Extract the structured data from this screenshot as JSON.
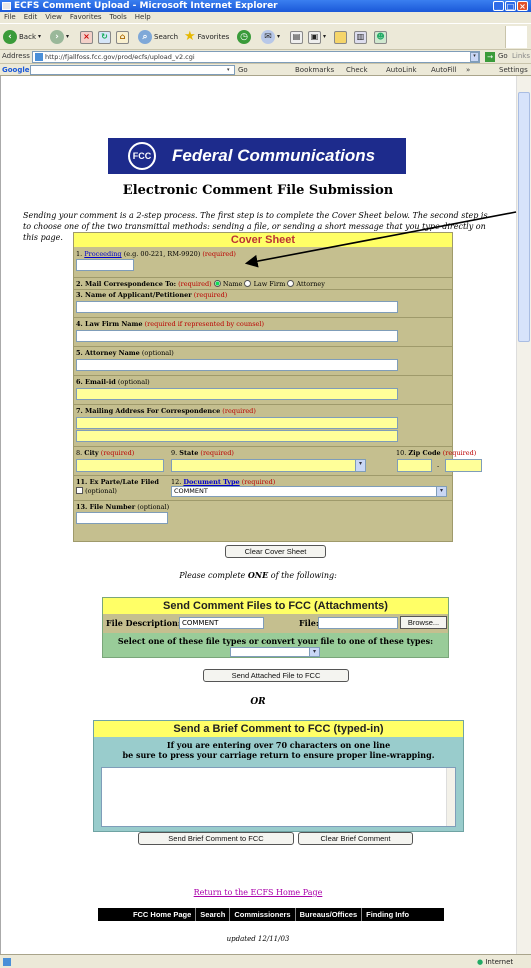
{
  "window": {
    "title": "ECFS Comment Upload - Microsoft Internet Explorer",
    "controls": [
      "_",
      "□",
      "×"
    ]
  },
  "menu": [
    "File",
    "Edit",
    "View",
    "Favorites",
    "Tools",
    "Help"
  ],
  "toolbar": {
    "back": "Back",
    "search": "Search",
    "favorites": "Favorites"
  },
  "address": {
    "label": "Address",
    "url": "http://fjallfoss.fcc.gov/prod/ecfs/upload_v2.cgi",
    "go": "Go",
    "links": "Links"
  },
  "google": {
    "label": "Google",
    "go": "Go",
    "bookmarks": "Bookmarks",
    "check": "Check",
    "autolink": "AutoLink",
    "autofill": "AutoFill",
    "more": "»",
    "settings": "Settings"
  },
  "banner": {
    "seal": "FCC",
    "title": "Federal Communications Commission"
  },
  "page_title": "Electronic Comment File Submission",
  "intro": "Sending your comment is a 2-step process. The first step is to complete the Cover Sheet below. The second step is to choose one of the two transmittal methods: sending a file, or sending a short message that you type directly on this page.",
  "cover": {
    "heading": "Cover Sheet",
    "proceeding": {
      "num": "1.",
      "link": "Proceeding",
      "hint": "(e.g. 00-221, RM-9920)",
      "req": "(required)"
    },
    "mail": {
      "label": "2. Mail Correspondence To:",
      "req": "(required)",
      "options": [
        "Name",
        "Law Firm",
        "Attorney"
      ],
      "selected": "Name"
    },
    "applicant": {
      "label": "3. Name of Applicant/Petitioner",
      "req": "(required)"
    },
    "lawfirm": {
      "label": "4. Law Firm Name",
      "req": "(required if represented by counsel)"
    },
    "attorney": {
      "label": "5. Attorney Name",
      "opt": "(optional)"
    },
    "email": {
      "label": "6. Email-id",
      "opt": "(optional)"
    },
    "address": {
      "label": "7. Mailing Address For Correspondence",
      "req": "(required)"
    },
    "city": {
      "num": "8.",
      "label": "City",
      "req": "(required)"
    },
    "state": {
      "num": "9.",
      "label": "State",
      "req": "(required)"
    },
    "zip": {
      "num": "10.",
      "label": "Zip Code",
      "req": "(required)",
      "sep": "-"
    },
    "exparte": {
      "label": "11. Ex Parte/Late Filed",
      "opt": "(optional)"
    },
    "doctype": {
      "num": "12.",
      "link": "Document Type",
      "req": "(required)",
      "value": "COMMENT"
    },
    "filenum": {
      "label": "13. File Number",
      "opt": "(optional)"
    },
    "clear": "Clear Cover Sheet"
  },
  "complete_one": {
    "pre": "Please complete ",
    "em": "ONE",
    "post": " of the following:"
  },
  "attach": {
    "heading": "Send Comment Files to FCC (Attachments)",
    "desc_label": "File Description:",
    "desc_value": "COMMENT",
    "file_label": "File:",
    "browse": "Browse...",
    "types_label": "Select one of these file types or convert your file to one of these types:",
    "send": "Send Attached File to FCC"
  },
  "or": "OR",
  "brief": {
    "heading": "Send a Brief Comment to FCC (typed-in)",
    "note1": "If you are entering over 70 characters on one line",
    "note2": "be sure to press your carriage return to ensure proper line-wrapping.",
    "send": "Send Brief Comment to FCC",
    "clear": "Clear Brief Comment"
  },
  "return_link": "Return to the ECFS Home Page",
  "nav": [
    "FCC Home Page",
    "Search",
    "Commissioners",
    "Bureaus/Offices",
    "Finding Info"
  ],
  "updated": "updated 12/11/03",
  "status": {
    "zone": "Internet"
  }
}
